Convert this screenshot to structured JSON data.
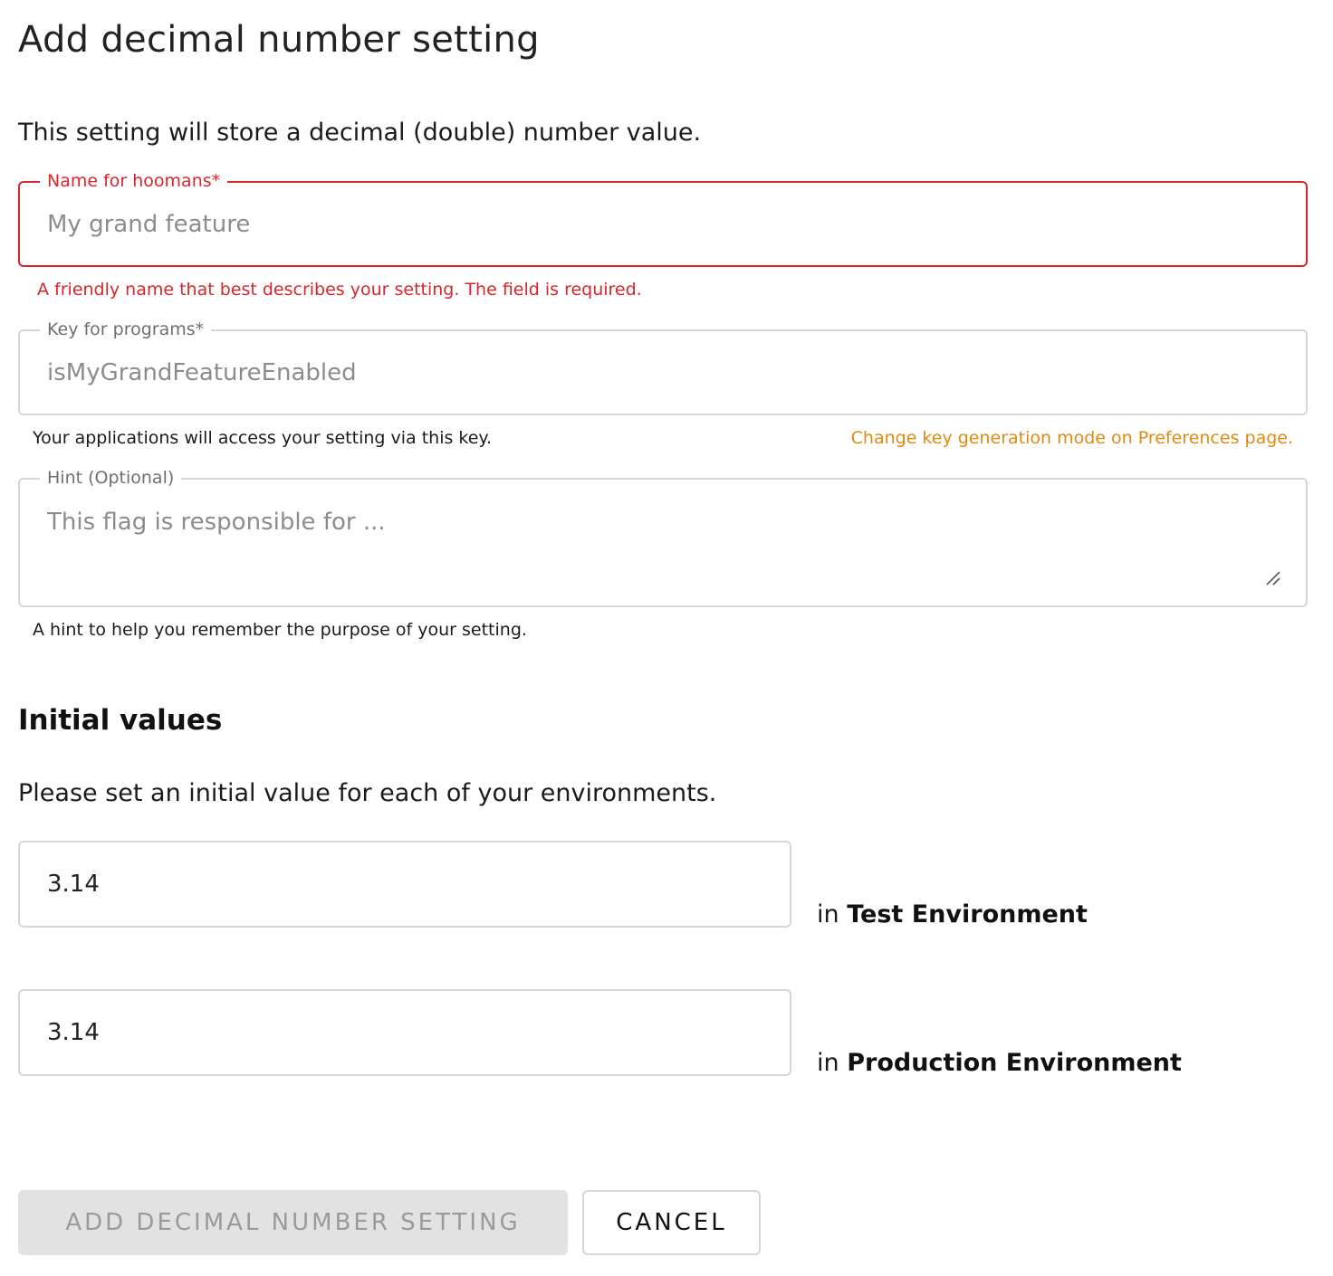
{
  "dialog": {
    "title": "Add decimal number setting",
    "description": "This setting will store a decimal (double) number value."
  },
  "name_field": {
    "label": "Name for hoomans*",
    "placeholder": "My grand feature",
    "value": "",
    "error": "A friendly name that best describes your setting. The field is required."
  },
  "key_field": {
    "label": "Key for programs*",
    "placeholder": "isMyGrandFeatureEnabled",
    "value": "",
    "helper": "Your applications will access your setting via this key.",
    "preferences_link": "Change key generation mode on Preferences page."
  },
  "hint_field": {
    "label": "Hint (Optional)",
    "placeholder": "This flag is responsible for ...",
    "value": "",
    "helper": "A hint to help you remember the purpose of your setting."
  },
  "initial_values": {
    "title": "Initial values",
    "description": "Please set an initial value for each of your environments.",
    "environments": [
      {
        "prefix": "in",
        "name": "Test Environment",
        "value": "3.14"
      },
      {
        "prefix": "in",
        "name": "Production Environment",
        "value": "3.14"
      }
    ]
  },
  "actions": {
    "submit_label": "ADD DECIMAL NUMBER SETTING",
    "cancel_label": "CANCEL"
  },
  "colors": {
    "error": "#d9262c",
    "link": "#e08a12",
    "border": "#d6d6d6",
    "disabled_button_bg": "#e2e2e2"
  }
}
